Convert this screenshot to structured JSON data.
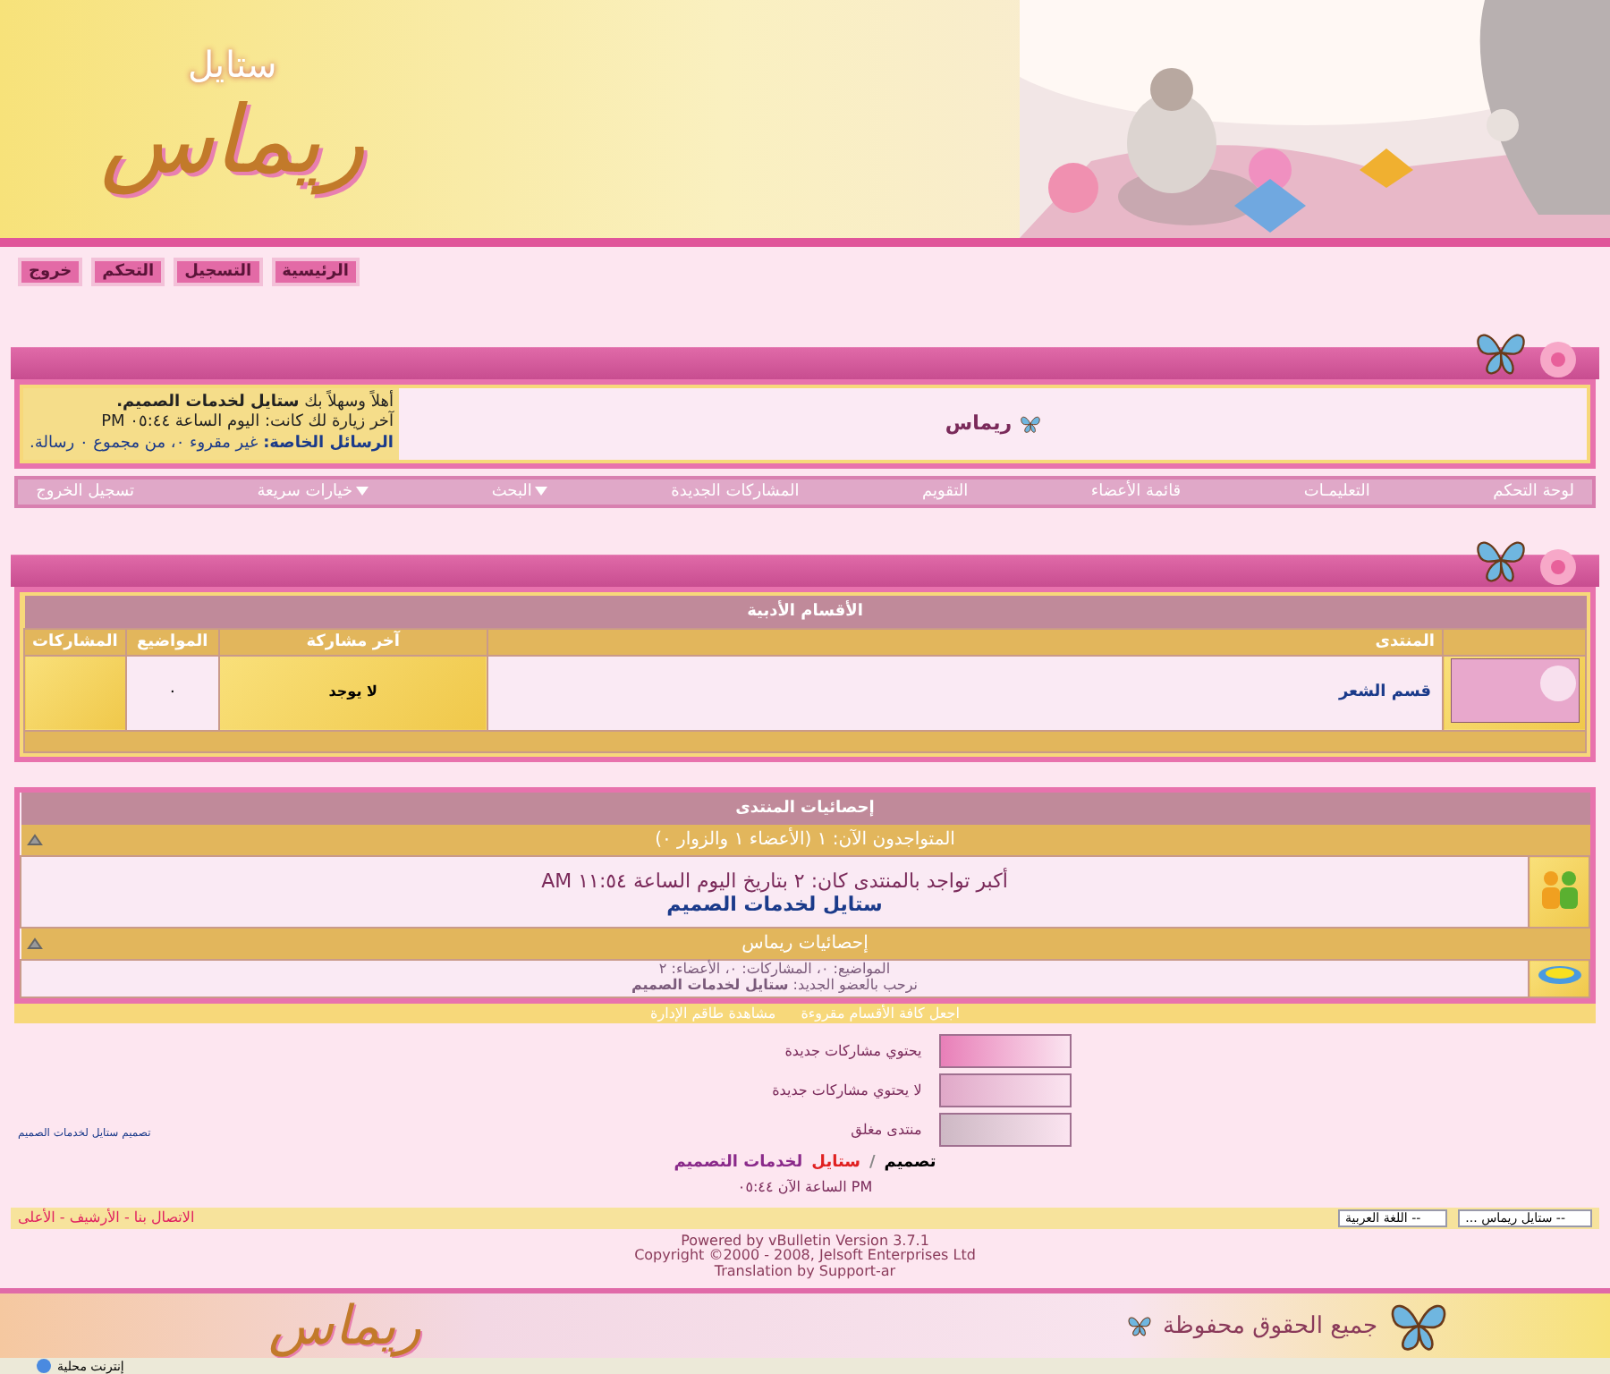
{
  "header": {
    "logo_small": "ستايل",
    "logo_big": "ريماس"
  },
  "top_buttons": [
    "الرئيسية",
    "التسجيل",
    "التحكم",
    "خروج"
  ],
  "user_box": {
    "forum_name": "ريماس",
    "welcome": "أهلاً وسهلاً بك **ستايل لخدمات الصميم.**",
    "last_visit": "آخر زيارة لك كانت: اليوم الساعة ٠٥:٤٤ PM",
    "messages": "**الرسائل الخاصة:** غير مقروء ٠، من مجموع ٠ رسالة."
  },
  "navbar": [
    {
      "label": "لوحة التحكم",
      "dropdown": false
    },
    {
      "label": "التعليمـات",
      "dropdown": false
    },
    {
      "label": "قائمة الأعضاء",
      "dropdown": false
    },
    {
      "label": "التقويم",
      "dropdown": false
    },
    {
      "label": "المشاركات الجديدة",
      "dropdown": false
    },
    {
      "label": "البحث",
      "dropdown": true
    },
    {
      "label": "خيارات سريعة",
      "dropdown": true
    },
    {
      "label": "تسجيل الخروج",
      "dropdown": false
    }
  ],
  "forum_table": {
    "title": "الأقسام الأدبية",
    "columns": [
      "المنتدى",
      "آخر مشاركة",
      "المواضيع",
      "المشاركات"
    ],
    "rows": [
      {
        "forum": "قسم الشعر",
        "last_post": "لا يوجد",
        "topics": "٠"
      }
    ]
  },
  "stats": {
    "title": "إحصائيات المنتدى",
    "online_title": "المتواجدون الآن: ١ (الأعضاء ١ والزوار ٠)",
    "record": "أكبر تواجد بالمنتدى كان: ٢ بتاريخ اليوم الساعة ١١:٥٤ AM",
    "online_user": "ستايل لخدمات الصميم",
    "forum_stats_title": "إحصائيات ريماس",
    "counts": "المواضيع: ٠، المشاركات: ٠، الأعضاء: ٢",
    "newest": "نرحب بالعضو الجديد: **ستايل لخدمات الصميم**",
    "links": [
      "اجعل كافة الأقسام مقروءة",
      "مشاهدة طاقم الإدارة"
    ]
  },
  "legend": [
    {
      "label": "يحتوي مشاركات جديدة",
      "color": "#e87fb8"
    },
    {
      "label": "لا يحتوي مشاركات جديدة",
      "color": "#e0a8c8"
    },
    {
      "label": "منتدى مغلق",
      "color": "#cdb8c4"
    }
  ],
  "side_link": "تصميم ستايل لخدمات الصميم",
  "credit": [
    {
      "text": "تصميم",
      "color": "#000000"
    },
    {
      "text": "/",
      "color": "#888888"
    },
    {
      "text": "ستايل",
      "color": "#e02020"
    },
    {
      "text": "لخدمات التصميم",
      "color": "#8a2a8a"
    }
  ],
  "time_now": "الساعة الآن ٠٥:٤٤ PM",
  "bottom_bar": {
    "links": "الاتصال بنا - الأرشيف - الأعلى",
    "style_select": "-- ستايل ريماس ...",
    "language_select": "-- اللغة العربية"
  },
  "powered": [
    "Powered by vBulletin Version 3.7.1",
    "Copyright ©2000 - 2008, Jelsoft Enterprises Ltd",
    "Translation by Support-ar"
  ],
  "footer": {
    "rights": "جميع الحقوق محفوظة",
    "logo_big": "ريماس"
  },
  "status_bar": {
    "zone": "إنترنت محلية"
  }
}
